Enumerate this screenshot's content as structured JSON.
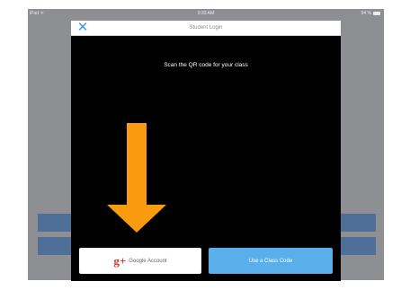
{
  "status_bar": {
    "carrier": "iPad ᯤ",
    "time": "9:33 AM",
    "battery": "94 %"
  },
  "modal": {
    "title": "Student Login",
    "close_icon": "close-icon",
    "close_glyph": "✕",
    "instruction": "Scan the QR code for your class"
  },
  "buttons": {
    "google_icon_glyph": "g+",
    "google_label": "Google Account",
    "class_code_label": "Use a Class Code"
  },
  "colors": {
    "modal_background": "#000000",
    "accent_blue": "#5aaeea",
    "close_blue": "#3d9bd6",
    "arrow_orange": "#f99b0f",
    "google_red": "#d7342a"
  }
}
